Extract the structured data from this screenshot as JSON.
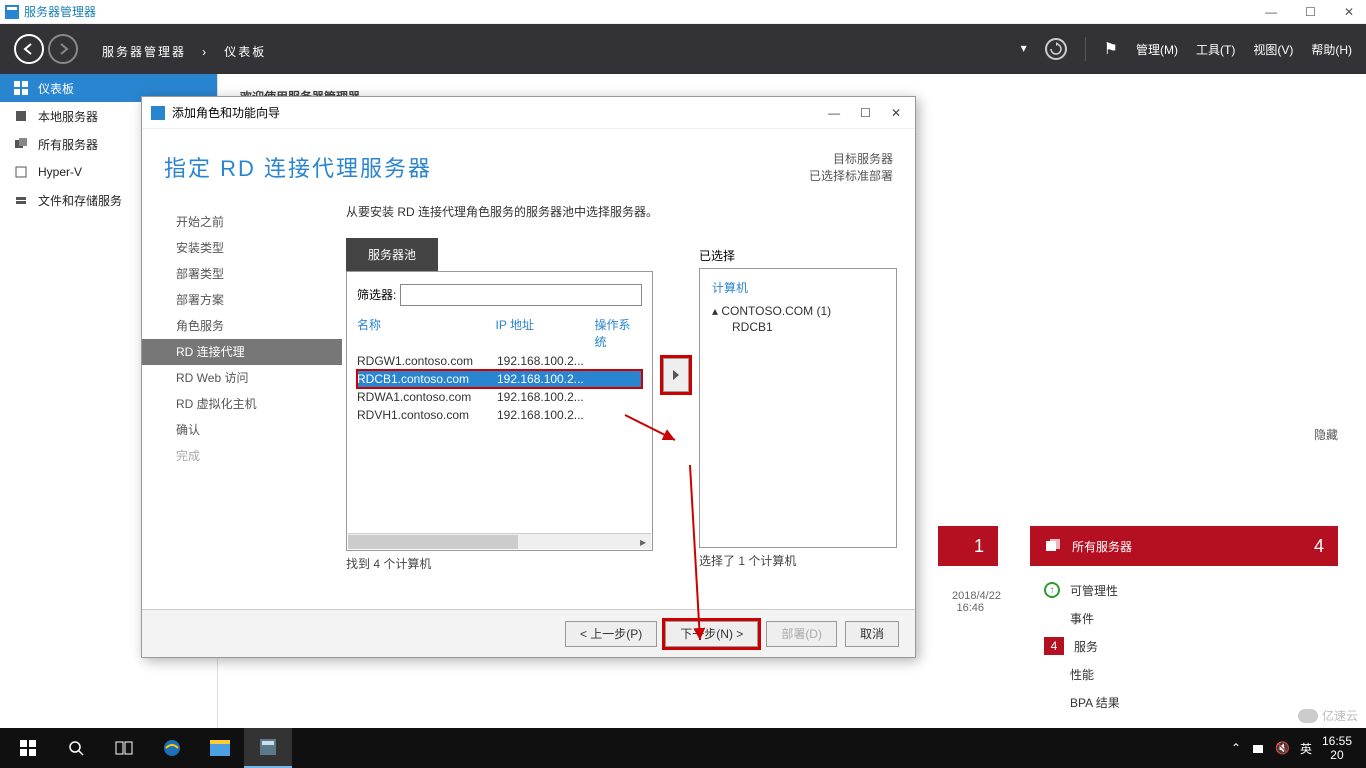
{
  "window": {
    "title": "服务器管理器"
  },
  "header": {
    "crumb_root": "服务器管理器",
    "crumb_page": "仪表板",
    "menu": {
      "manage": "管理(M)",
      "tools": "工具(T)",
      "view": "视图(V)",
      "help": "帮助(H)"
    }
  },
  "sidebar": {
    "items": [
      {
        "label": "仪表板"
      },
      {
        "label": "本地服务器"
      },
      {
        "label": "所有服务器"
      },
      {
        "label": "Hyper-V"
      },
      {
        "label": "文件和存储服务"
      }
    ]
  },
  "content": {
    "welcome": "欢迎使用服务器管理器",
    "hide": "隐藏"
  },
  "tiles": [
    {
      "title": "",
      "count": "1",
      "rows": [],
      "time": "2018/4/22 16:46"
    },
    {
      "title": "所有服务器",
      "count": "4",
      "rows": [
        {
          "icon": "up",
          "label": "可管理性"
        },
        {
          "icon": "",
          "label": "事件"
        },
        {
          "icon": "badge",
          "badge": "4",
          "label": "服务"
        },
        {
          "icon": "",
          "label": "性能"
        },
        {
          "icon": "",
          "label": "BPA 结果"
        }
      ],
      "time": "2018/4/22 16:46"
    }
  ],
  "wizard": {
    "title": "添加角色和功能向导",
    "heading": "指定 RD 连接代理服务器",
    "target_label": "目标服务器",
    "target_value": "已选择标准部署",
    "nav": [
      {
        "label": "开始之前",
        "state": "done"
      },
      {
        "label": "安装类型",
        "state": "done"
      },
      {
        "label": "部署类型",
        "state": "done"
      },
      {
        "label": "部署方案",
        "state": "done"
      },
      {
        "label": "角色服务",
        "state": "done"
      },
      {
        "label": "RD 连接代理",
        "state": "current"
      },
      {
        "label": "RD Web 访问",
        "state": ""
      },
      {
        "label": "RD 虚拟化主机",
        "state": ""
      },
      {
        "label": "确认",
        "state": ""
      },
      {
        "label": "完成",
        "state": "disabled"
      }
    ],
    "desc": "从要安装 RD 连接代理角色服务的服务器池中选择服务器。",
    "pool": {
      "tab": "服务器池",
      "filter_label": "筛选器:",
      "filter_value": "",
      "cols": {
        "name": "名称",
        "ip": "IP 地址",
        "os": "操作系统"
      },
      "rows": [
        {
          "name": "RDGW1.contoso.com",
          "ip": "192.168.100.2...",
          "sel": false
        },
        {
          "name": "RDCB1.contoso.com",
          "ip": "192.168.100.2...",
          "sel": true
        },
        {
          "name": "RDWA1.contoso.com",
          "ip": "192.168.100.2...",
          "sel": false
        },
        {
          "name": "RDVH1.contoso.com",
          "ip": "192.168.100.2...",
          "sel": false
        }
      ],
      "footer": "找到 4 个计算机"
    },
    "selected": {
      "heading": "已选择",
      "col": "计算机",
      "parent": "CONTOSO.COM (1)",
      "child": "RDCB1",
      "footer": "选择了 1 个计算机"
    },
    "buttons": {
      "prev": "< 上一步(P)",
      "next": "下一步(N) >",
      "deploy": "部署(D)",
      "cancel": "取消"
    }
  },
  "taskbar": {
    "ime": "英",
    "time": "16:55",
    "date": "20"
  },
  "watermark": "亿速云"
}
